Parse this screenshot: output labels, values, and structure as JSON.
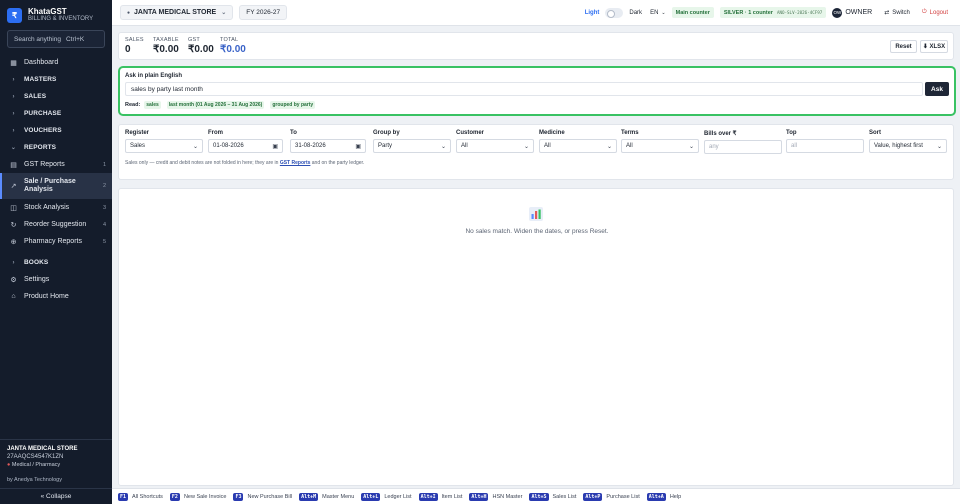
{
  "app": {
    "name": "KhataGST",
    "subtitle": "BILLING & INVENTORY",
    "logo_glyph": "₹"
  },
  "search": {
    "placeholder": "Search anything",
    "shortcut": "Ctrl+K"
  },
  "sidebar": {
    "dashboard": "Dashboard",
    "masters": "MASTERS",
    "sales": "SALES",
    "purchase": "PURCHASE",
    "vouchers": "VOUCHERS",
    "reports": "REPORTS",
    "gst_reports": {
      "label": "GST Reports",
      "num": "1"
    },
    "sale_purchase": {
      "label1": "Sale / Purchase",
      "label2": "Analysis",
      "num": "2"
    },
    "stock_analysis": {
      "label": "Stock Analysis",
      "num": "3"
    },
    "reorder": {
      "label": "Reorder Suggestion",
      "num": "4"
    },
    "pharmacy": {
      "label": "Pharmacy Reports",
      "num": "5"
    },
    "books": "BOOKS",
    "settings": "Settings",
    "product_home": "Product Home"
  },
  "store": {
    "name": "JANTA MEDICAL STORE",
    "gstin": "27AAQCS4547K1ZN",
    "type": "Medical / Pharmacy"
  },
  "vendor": "by Anedya Technology",
  "collapse": "« Collapse",
  "topbar": {
    "store": "JANTA MEDICAL STORE",
    "fy": "FY 2026-27",
    "light": "Light",
    "dark": "Dark",
    "lang": "EN",
    "main_counter": "Main counter",
    "license": "SILVER · 1 counter",
    "license_code": "ANO-SLV-2026-4CF97",
    "owner_initials": "OW",
    "owner": "OWNER",
    "switch": "Switch",
    "logout": "Logout"
  },
  "summary": {
    "sales_label": "SALES",
    "sales_value": "0",
    "taxable_label": "TAXABLE",
    "taxable_value": "₹0.00",
    "gst_label": "GST",
    "gst_value": "₹0.00",
    "total_label": "TOTAL",
    "total_value": "₹0.00",
    "reset": "Reset",
    "xlsx": "⬇ XLSX"
  },
  "ask": {
    "label": "Ask in plain English",
    "query": "sales by party last month",
    "button": "Ask",
    "read_label": "Read:",
    "tags": [
      "sales",
      "last month (01 Aug 2026 – 31 Aug 2026)",
      "grouped by party"
    ]
  },
  "filters": {
    "register": {
      "label": "Register",
      "value": "Sales"
    },
    "from": {
      "label": "From",
      "value": "01-08-2026"
    },
    "to": {
      "label": "To",
      "value": "31-08-2026"
    },
    "group_by": {
      "label": "Group by",
      "value": "Party"
    },
    "customer": {
      "label": "Customer",
      "value": "All"
    },
    "medicine": {
      "label": "Medicine",
      "value": "All"
    },
    "terms": {
      "label": "Terms",
      "value": "All"
    },
    "bills_over": {
      "label": "Bills over ₹",
      "placeholder": "any"
    },
    "top": {
      "label": "Top",
      "placeholder": "all"
    },
    "sort": {
      "label": "Sort",
      "value": "Value, highest first"
    },
    "note_before": "Sales only — credit and debit notes are not folded in here; they are in",
    "note_link": "GST Reports",
    "note_after": "and on the party ledger."
  },
  "results": {
    "empty_message": "No sales match. Widen the dates, or press Reset."
  },
  "shortcuts": [
    {
      "key": "F1",
      "label": "All Shortcuts"
    },
    {
      "key": "F2",
      "label": "New Sale Invoice"
    },
    {
      "key": "F3",
      "label": "New Purchase Bill"
    },
    {
      "key": "Alt+M",
      "label": "Master Menu"
    },
    {
      "key": "Alt+L",
      "label": "Ledger List"
    },
    {
      "key": "Alt+I",
      "label": "Item List"
    },
    {
      "key": "Alt+H",
      "label": "HSN Master"
    },
    {
      "key": "Alt+S",
      "label": "Sales List"
    },
    {
      "key": "Alt+P",
      "label": "Purchase List"
    },
    {
      "key": "Alt+A",
      "label": "Help"
    }
  ],
  "colors": {
    "accent": "#2c6ef2",
    "sidebar_bg": "#141c2b",
    "ask_border": "#39c263",
    "shortcut_key": "#2a3bb0",
    "total": "#3a63c8"
  }
}
